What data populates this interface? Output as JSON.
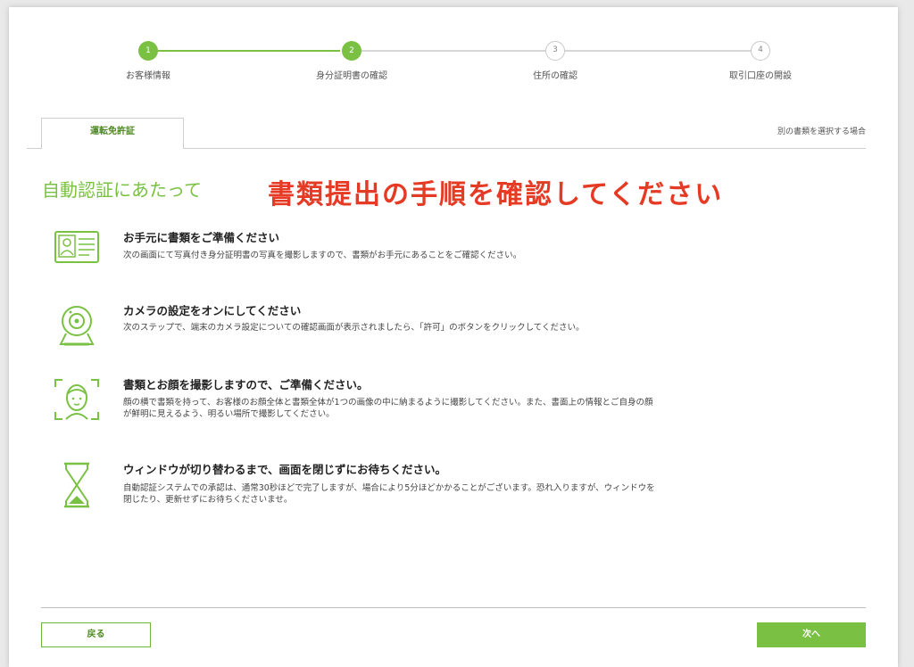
{
  "stepper": {
    "steps": [
      {
        "number": "1",
        "label": "お客様情報",
        "status": "done"
      },
      {
        "number": "2",
        "label": "身分証明書の確認",
        "status": "current"
      },
      {
        "number": "3",
        "label": "住所の確認",
        "status": "todo"
      },
      {
        "number": "4",
        "label": "取引口座の開設",
        "status": "todo"
      }
    ]
  },
  "tabs": {
    "active_label": "運転免許証",
    "other_document_link": "別の書類を選択する場合"
  },
  "section": {
    "title": "自動認証にあたって",
    "overlay_heading": "書類提出の手順を確認してください"
  },
  "items": [
    {
      "icon": "id-card-icon",
      "title": "お手元に書類をご準備ください",
      "description": "次の画面にて写真付き身分証明書の写真を撮影しますので、書類がお手元にあることをご確認ください。"
    },
    {
      "icon": "webcam-icon",
      "title": "カメラの設定をオンにしてください",
      "description": "次のステップで、端末のカメラ設定についての確認画面が表示されましたら、「許可」のボタンをクリックしてください。"
    },
    {
      "icon": "face-scan-icon",
      "title": "書類とお顔を撮影しますので、ご準備ください。",
      "description": "顔の横で書類を持って、お客様のお顔全体と書類全体が1つの画像の中に納まるように撮影してください。また、書面上の情報とご自身の顔が鮮明に見えるよう、明るい場所で撮影してください。"
    },
    {
      "icon": "hourglass-icon",
      "title": "ウィンドウが切り替わるまで、画面を閉じずにお待ちください。",
      "description": "自動認証システムでの承認は、通常30秒ほどで完了しますが、場合により5分ほどかかることがございます。恐れ入りますが、ウィンドウを閉じたり、更新せずにお待ちくださいませ。"
    }
  ],
  "footer": {
    "back_label": "戻る",
    "next_label": "次へ"
  },
  "colors": {
    "accent": "#7ac143",
    "overlay_red": "#e53a24"
  }
}
